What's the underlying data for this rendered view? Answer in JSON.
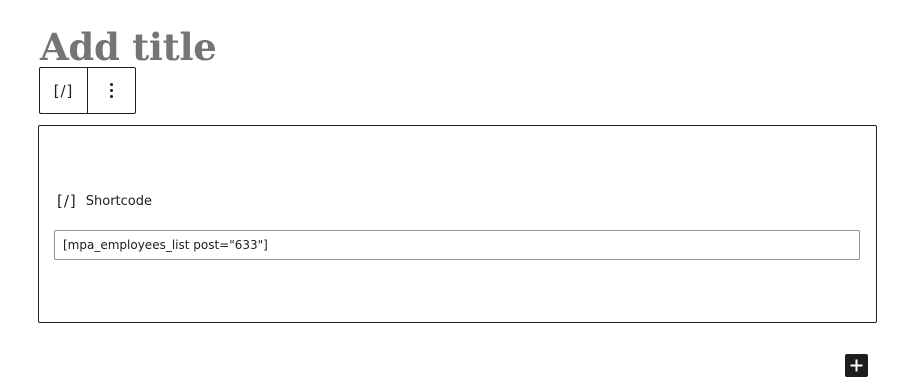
{
  "editor": {
    "title_placeholder": "Add title"
  },
  "block_toolbar": {
    "block_type_icon": "shortcode-icon",
    "block_type_glyph": "[/]",
    "options_icon": "more-vertical-icon"
  },
  "shortcode_block": {
    "icon": "shortcode-icon",
    "icon_glyph": "[/]",
    "label": "Shortcode",
    "input_value": "[mpa_employees_list post=\"633\"]"
  },
  "inserter": {
    "icon": "plus-icon"
  },
  "colors": {
    "text": "#1e1e1e",
    "title_placeholder": "#757575",
    "input_border": "#949494",
    "background": "#ffffff"
  }
}
